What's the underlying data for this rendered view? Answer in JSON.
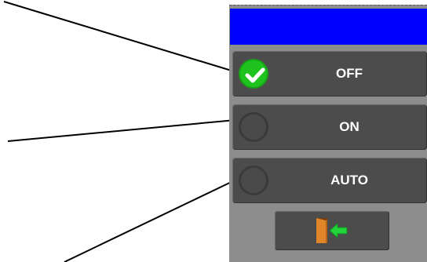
{
  "panel": {
    "title_color": "#0000ff",
    "modes": [
      {
        "label": "OFF",
        "selected": true
      },
      {
        "label": "ON",
        "selected": false
      },
      {
        "label": "AUTO",
        "selected": false
      }
    ],
    "exit_icon": "exit-door-icon",
    "check_color": "#1ec31e"
  }
}
